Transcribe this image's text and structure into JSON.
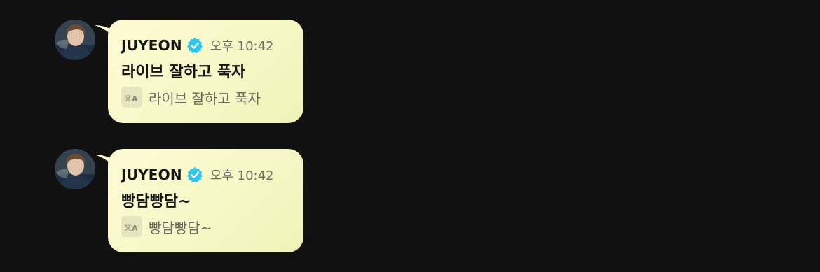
{
  "messages": [
    {
      "sender": "JUYEON",
      "time": "오후 10:42",
      "text": "라이브 잘하고 푹자",
      "translation": "라이브 잘하고 푹자"
    },
    {
      "sender": "JUYEON",
      "time": "오후 10:42",
      "text": "빵담빵담~",
      "translation": "빵담빵담~"
    }
  ],
  "icons": {
    "verified": "verified-badge-icon",
    "translate": "translate-icon",
    "avatar": "profile-avatar"
  },
  "colors": {
    "background": "#111112",
    "bubble": "#f6f8c6",
    "verified": "#2ec5f0"
  }
}
